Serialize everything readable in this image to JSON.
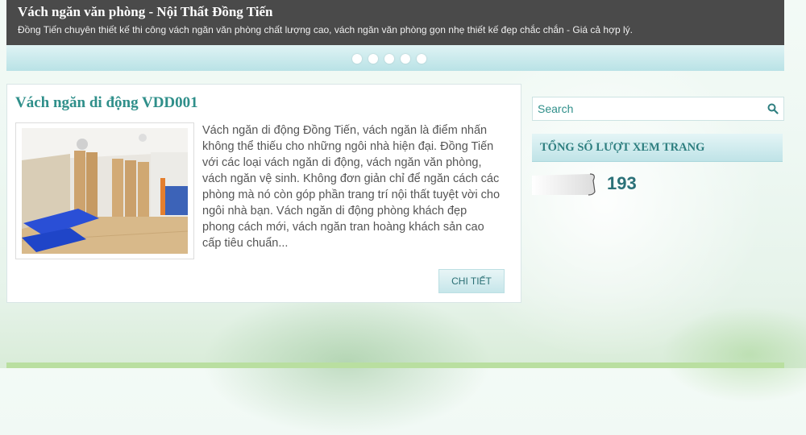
{
  "header": {
    "title": "Vách ngăn văn phòng - Nội Thất Đồng Tiến",
    "description": "Đồng Tiến chuyên thiết kế thi công vách ngăn văn phòng chất lượng cao, vách ngăn văn phòng gọn nhẹ thiết kế đẹp chắc chắn - Giá cả hợp lý."
  },
  "slider": {
    "dot_count": 5
  },
  "post": {
    "title": "Vách ngăn di động VDD001",
    "excerpt": "Vách ngăn di động Đồng Tiến, vách ngăn là điểm nhấn không thể thiếu cho những ngôi nhà hiện đại. Đồng Tiến với các loại vách ngăn di động, vách ngăn văn phòng, vách ngăn vệ sinh.   Không đơn giản chỉ để ngăn cách các phòng mà nó còn góp phần trang trí nội thất tuyệt vời cho ngôi nhà bạn.   Vách ngăn di động phòng khách đẹp phong cách mới, vách ngăn tran hoàng khách sản cao cấp tiêu chuẩn...",
    "more_label": "CHI TIẾT",
    "thumbnail_icon": "room-partition-photo"
  },
  "sidebar": {
    "search": {
      "placeholder": "Search",
      "icon": "search-icon"
    },
    "pageviews": {
      "heading": "TỔNG SỐ LƯỢT XEM TRANG",
      "count": "193"
    }
  },
  "colors": {
    "header_bg": "#4a4a4a",
    "accent": "#2f8f8a",
    "slider_bg": "#b9e2e6"
  }
}
